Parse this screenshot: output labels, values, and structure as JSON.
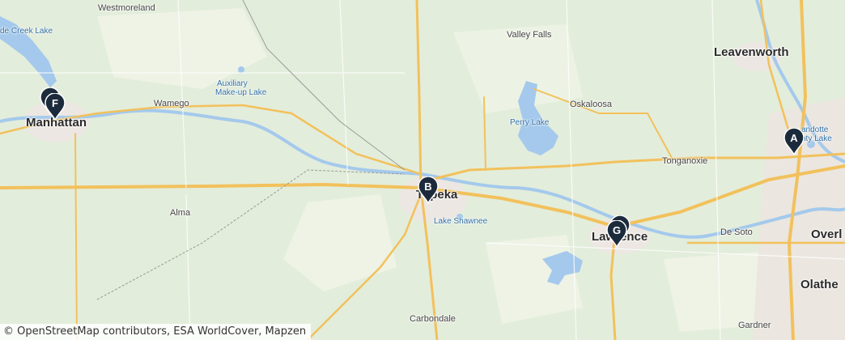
{
  "places": {
    "westmoreland": "Westmoreland",
    "tuttle_creek_lake": "de Creek Lake",
    "manhattan": "Manhattan",
    "wamego": "Wamego",
    "auxiliary_lake_1": "Auxiliary",
    "auxiliary_lake_2": "Make-up Lake",
    "valley_falls": "Valley Falls",
    "leavenworth": "Leavenworth",
    "oskaloosa": "Oskaloosa",
    "perry_lake": "Perry Lake",
    "wyandotte_lake_1": "andotte",
    "wyandotte_lake_2": "nty Lake",
    "tonganoxie": "Tonganoxie",
    "topeka": "Topeka",
    "alma": "Alma",
    "lake_shawnee": "Lake Shawnee",
    "lawrence": "Lawrence",
    "de_soto": "De Soto",
    "overland": "Overl",
    "olathe": "Olathe",
    "carbondale": "Carbondale",
    "gardner": "Gardner"
  },
  "markers": [
    {
      "label": "A"
    },
    {
      "label": "B"
    },
    {
      "label": "F"
    },
    {
      "label": "G"
    }
  ],
  "colors": {
    "land": "#e3eddb",
    "water": "#a4c9ec",
    "highway": "#f2c15c",
    "marker": "#1c2b3c"
  },
  "attribution": "© OpenStreetMap contributors, ESA WorldCover, Mapzen"
}
